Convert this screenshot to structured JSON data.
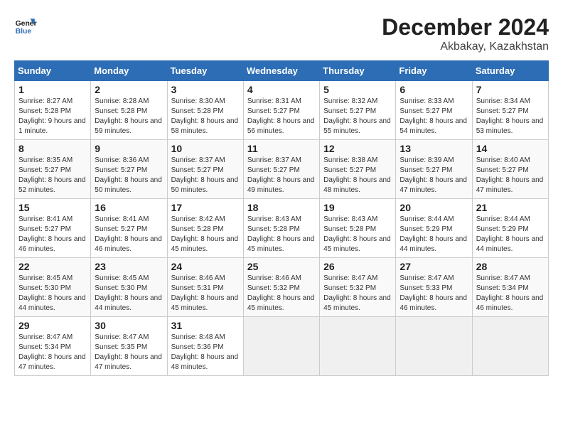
{
  "header": {
    "logo_line1": "General",
    "logo_line2": "Blue",
    "month": "December 2024",
    "location": "Akbakay, Kazakhstan"
  },
  "days_of_week": [
    "Sunday",
    "Monday",
    "Tuesday",
    "Wednesday",
    "Thursday",
    "Friday",
    "Saturday"
  ],
  "weeks": [
    [
      {
        "day": 1,
        "info": "Sunrise: 8:27 AM\nSunset: 5:28 PM\nDaylight: 9 hours and 1 minute."
      },
      {
        "day": 2,
        "info": "Sunrise: 8:28 AM\nSunset: 5:28 PM\nDaylight: 8 hours and 59 minutes."
      },
      {
        "day": 3,
        "info": "Sunrise: 8:30 AM\nSunset: 5:28 PM\nDaylight: 8 hours and 58 minutes."
      },
      {
        "day": 4,
        "info": "Sunrise: 8:31 AM\nSunset: 5:27 PM\nDaylight: 8 hours and 56 minutes."
      },
      {
        "day": 5,
        "info": "Sunrise: 8:32 AM\nSunset: 5:27 PM\nDaylight: 8 hours and 55 minutes."
      },
      {
        "day": 6,
        "info": "Sunrise: 8:33 AM\nSunset: 5:27 PM\nDaylight: 8 hours and 54 minutes."
      },
      {
        "day": 7,
        "info": "Sunrise: 8:34 AM\nSunset: 5:27 PM\nDaylight: 8 hours and 53 minutes."
      }
    ],
    [
      {
        "day": 8,
        "info": "Sunrise: 8:35 AM\nSunset: 5:27 PM\nDaylight: 8 hours and 52 minutes."
      },
      {
        "day": 9,
        "info": "Sunrise: 8:36 AM\nSunset: 5:27 PM\nDaylight: 8 hours and 50 minutes."
      },
      {
        "day": 10,
        "info": "Sunrise: 8:37 AM\nSunset: 5:27 PM\nDaylight: 8 hours and 50 minutes."
      },
      {
        "day": 11,
        "info": "Sunrise: 8:37 AM\nSunset: 5:27 PM\nDaylight: 8 hours and 49 minutes."
      },
      {
        "day": 12,
        "info": "Sunrise: 8:38 AM\nSunset: 5:27 PM\nDaylight: 8 hours and 48 minutes."
      },
      {
        "day": 13,
        "info": "Sunrise: 8:39 AM\nSunset: 5:27 PM\nDaylight: 8 hours and 47 minutes."
      },
      {
        "day": 14,
        "info": "Sunrise: 8:40 AM\nSunset: 5:27 PM\nDaylight: 8 hours and 47 minutes."
      }
    ],
    [
      {
        "day": 15,
        "info": "Sunrise: 8:41 AM\nSunset: 5:27 PM\nDaylight: 8 hours and 46 minutes."
      },
      {
        "day": 16,
        "info": "Sunrise: 8:41 AM\nSunset: 5:27 PM\nDaylight: 8 hours and 46 minutes."
      },
      {
        "day": 17,
        "info": "Sunrise: 8:42 AM\nSunset: 5:28 PM\nDaylight: 8 hours and 45 minutes."
      },
      {
        "day": 18,
        "info": "Sunrise: 8:43 AM\nSunset: 5:28 PM\nDaylight: 8 hours and 45 minutes."
      },
      {
        "day": 19,
        "info": "Sunrise: 8:43 AM\nSunset: 5:28 PM\nDaylight: 8 hours and 45 minutes."
      },
      {
        "day": 20,
        "info": "Sunrise: 8:44 AM\nSunset: 5:29 PM\nDaylight: 8 hours and 44 minutes."
      },
      {
        "day": 21,
        "info": "Sunrise: 8:44 AM\nSunset: 5:29 PM\nDaylight: 8 hours and 44 minutes."
      }
    ],
    [
      {
        "day": 22,
        "info": "Sunrise: 8:45 AM\nSunset: 5:30 PM\nDaylight: 8 hours and 44 minutes."
      },
      {
        "day": 23,
        "info": "Sunrise: 8:45 AM\nSunset: 5:30 PM\nDaylight: 8 hours and 44 minutes."
      },
      {
        "day": 24,
        "info": "Sunrise: 8:46 AM\nSunset: 5:31 PM\nDaylight: 8 hours and 45 minutes."
      },
      {
        "day": 25,
        "info": "Sunrise: 8:46 AM\nSunset: 5:32 PM\nDaylight: 8 hours and 45 minutes."
      },
      {
        "day": 26,
        "info": "Sunrise: 8:47 AM\nSunset: 5:32 PM\nDaylight: 8 hours and 45 minutes."
      },
      {
        "day": 27,
        "info": "Sunrise: 8:47 AM\nSunset: 5:33 PM\nDaylight: 8 hours and 46 minutes."
      },
      {
        "day": 28,
        "info": "Sunrise: 8:47 AM\nSunset: 5:34 PM\nDaylight: 8 hours and 46 minutes."
      }
    ],
    [
      {
        "day": 29,
        "info": "Sunrise: 8:47 AM\nSunset: 5:34 PM\nDaylight: 8 hours and 47 minutes."
      },
      {
        "day": 30,
        "info": "Sunrise: 8:47 AM\nSunset: 5:35 PM\nDaylight: 8 hours and 47 minutes."
      },
      {
        "day": 31,
        "info": "Sunrise: 8:48 AM\nSunset: 5:36 PM\nDaylight: 8 hours and 48 minutes."
      },
      null,
      null,
      null,
      null
    ]
  ]
}
